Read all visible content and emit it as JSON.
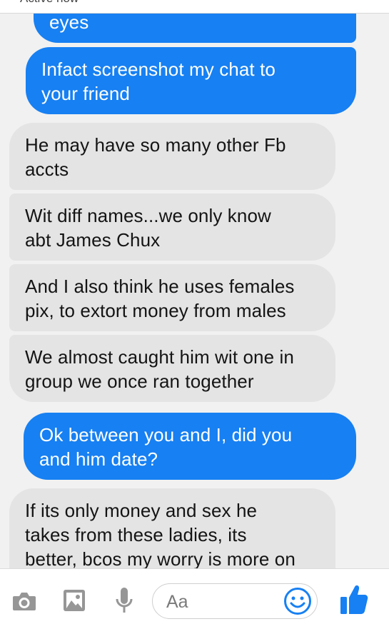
{
  "header": {
    "status": "Active now"
  },
  "messages": [
    {
      "from": "me",
      "lines": [
        "eyes"
      ]
    },
    {
      "from": "me",
      "lines": [
        "Infact screenshot my chat to",
        "your friend"
      ]
    },
    {
      "from": "them",
      "lines": [
        "He may have so many other Fb",
        "accts"
      ]
    },
    {
      "from": "them",
      "lines": [
        "Wit diff names...we only know",
        "abt James Chux"
      ]
    },
    {
      "from": "them",
      "lines": [
        "And I also think he uses females",
        "pix, to extort money from males"
      ]
    },
    {
      "from": "them",
      "lines": [
        "We almost caught him wit one in",
        "group we once ran together"
      ]
    },
    {
      "from": "me",
      "lines": [
        "Ok between you and I, did you",
        "and him date?"
      ]
    },
    {
      "from": "them",
      "lines": [
        "If its only money and sex he",
        "takes from these ladies, its",
        "better, bcos my worry is more on"
      ]
    }
  ],
  "composer": {
    "placeholder": "Aa",
    "icons": [
      "camera-icon",
      "gallery-icon",
      "microphone-icon",
      "emoji-icon",
      "thumbs-up-icon"
    ]
  },
  "colors": {
    "outgoing_bubble": "#1780f2",
    "incoming_bubble": "#e4e4e4",
    "accent": "#1780f2"
  }
}
